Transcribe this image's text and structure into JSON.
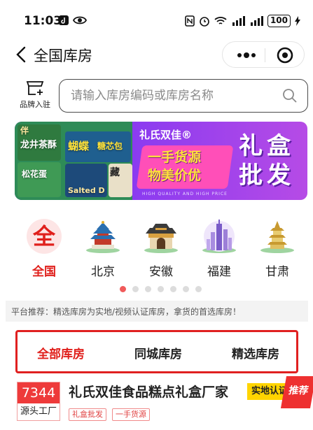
{
  "status": {
    "time": "11:03",
    "battery": "100"
  },
  "nav": {
    "title": "全国库房"
  },
  "brand_entry": {
    "label": "品牌入驻"
  },
  "search": {
    "placeholder": "请输入库房编码或库房名称"
  },
  "banner": {
    "brand": "礼氏双佳®",
    "slogan_line1": "一手货源",
    "slogan_line2": "物美价优",
    "big_line1": "礼盒",
    "big_line2": "批发",
    "tagline": "HIGH QUALITY AND HIGH PRICE",
    "product_texts": [
      "伴",
      "龙井茶酥",
      "松花蛋",
      "蝴蝶",
      "糖芯包",
      "藏",
      "Salted D"
    ]
  },
  "categories": [
    {
      "label": "全国",
      "icon_text": "全",
      "active": true
    },
    {
      "label": "北京"
    },
    {
      "label": "安徽"
    },
    {
      "label": "福建"
    },
    {
      "label": "甘肃"
    }
  ],
  "pagination": {
    "count": 7,
    "active_index": 0
  },
  "recommend": {
    "text": "平台推荐：精选库房为实地/视频认证库房，拿货的首选库房！"
  },
  "tabs": [
    {
      "label": "全部库房",
      "active": true
    },
    {
      "label": "同城库房"
    },
    {
      "label": "精选库房"
    }
  ],
  "warehouse": {
    "code": "7344",
    "type": "源头工厂",
    "name": "礼氏双佳食品糕点礼盒厂家",
    "tags": [
      "礼盒批发",
      "一手货源"
    ],
    "badge": "实地认证",
    "ribbon": "推荐"
  },
  "colors": {
    "accent": "#e0201c",
    "banner_purple": "#8a3bf0",
    "badge_yellow": "#ffd400"
  }
}
